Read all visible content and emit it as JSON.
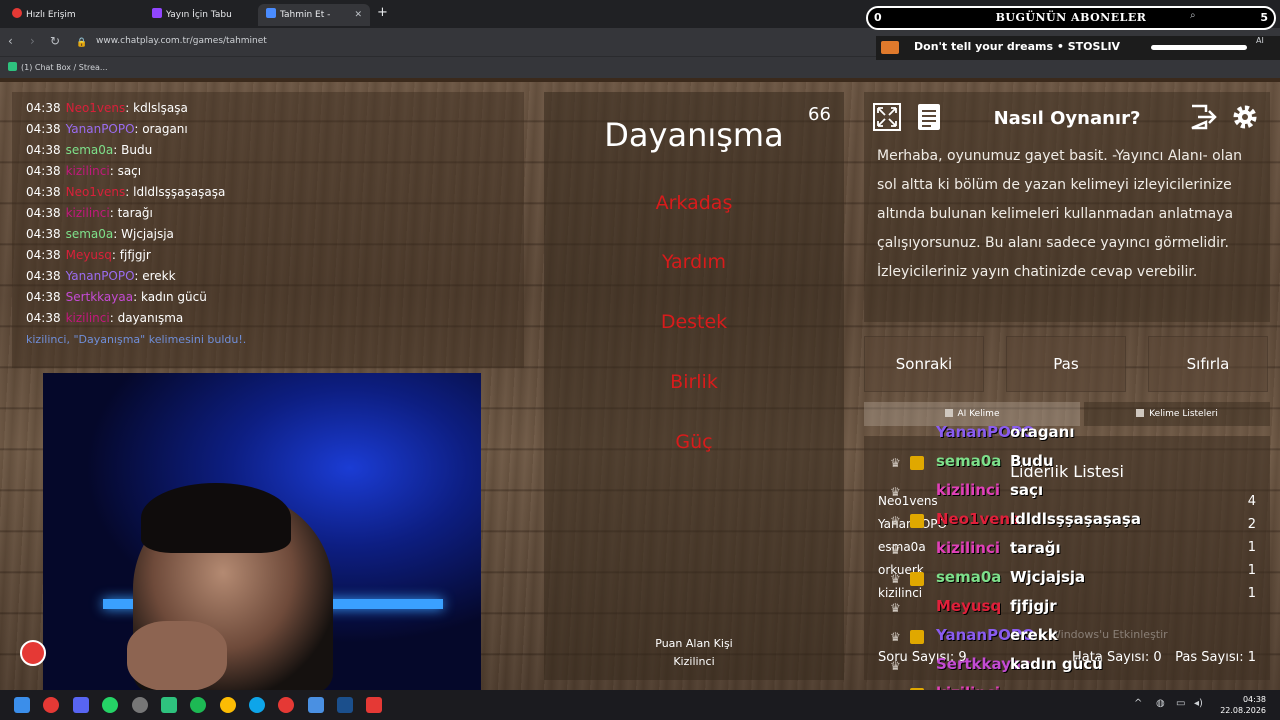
{
  "browser": {
    "tabs": [
      {
        "label": "Hızlı Erişim"
      },
      {
        "label": "Yayın İçin Tabu Oyna"
      },
      {
        "label": "Tahmin Et - ChatPlay"
      }
    ],
    "url": "www.chatplay.com.tr/games/tahminet",
    "bookmark": "(1) Chat Box / Strea..."
  },
  "overlay": {
    "subs_title": "BUGÜNÜN ABONELER",
    "subs_count": "0",
    "subs_count_right": "5",
    "now_playing": "Don't tell your dreams  •  STOSLIV",
    "ai_tag": "AI"
  },
  "chat": {
    "lines": [
      {
        "time": "04:38",
        "user": "Neo1vens",
        "color": "#d8203a",
        "msg": "kdlslşaşa"
      },
      {
        "time": "04:38",
        "user": "YananPOPO",
        "color": "#9a6cf0",
        "msg": "oraganı"
      },
      {
        "time": "04:38",
        "user": "sema0a",
        "color": "#7ee08a",
        "msg": "Budu"
      },
      {
        "time": "04:38",
        "user": "kizilinci",
        "color": "#c2187c",
        "msg": "saçı"
      },
      {
        "time": "04:38",
        "user": "Neo1vens",
        "color": "#d8203a",
        "msg": "ldldlsşşaşaşaşa"
      },
      {
        "time": "04:38",
        "user": "kizilinci",
        "color": "#c2187c",
        "msg": "tarağı"
      },
      {
        "time": "04:38",
        "user": "sema0a",
        "color": "#7ee08a",
        "msg": "Wjcjajsja"
      },
      {
        "time": "04:38",
        "user": "Meyusq",
        "color": "#d8203a",
        "msg": "fjfjgjr"
      },
      {
        "time": "04:38",
        "user": "YananPOPO",
        "color": "#9a6cf0",
        "msg": "erekk"
      },
      {
        "time": "04:38",
        "user": "Sertkkayaa",
        "color": "#c44bd4",
        "msg": "kadın gücü"
      },
      {
        "time": "04:38",
        "user": "kizilinci",
        "color": "#c2187c",
        "msg": "dayanışma"
      }
    ],
    "found": "kizilinci, \"Dayanışma\" kelimesini buldu!."
  },
  "game": {
    "timer": "66",
    "word": "Dayanışma",
    "taboo": [
      "Arkadaş",
      "Yardım",
      "Destek",
      "Birlik",
      "Güç"
    ],
    "scorer_label": "Puan Alan Kişi",
    "scorer_name": "Kizilinci"
  },
  "info": {
    "title": "Nasıl Oynanır?",
    "text": "Merhaba, oyunumuz gayet basit. -Yayıncı Alanı- olan sol altta ki bölüm de yazan kelimeyi izleyicilerinize altında bulunan kelimeleri kullanmadan anlatmaya çalışıyorsunuz. Bu alanı sadece yayıncı görmelidir. İzleyicileriniz yayın chatinizde cevap verebilir."
  },
  "actions": {
    "next": "Sonraki",
    "pass": "Pas",
    "reset": "Sıfırla"
  },
  "lists": {
    "ai_word": "AI Kelime",
    "word_lists": "Kelime Listeleri"
  },
  "leaderboard": {
    "title": "Liderlik Listesi",
    "entries": [
      {
        "name": "Neo1vens",
        "score": "4"
      },
      {
        "name": "YananPOPO",
        "score": "2"
      },
      {
        "name": "esma0a",
        "score": "1"
      },
      {
        "name": "orkuerk",
        "score": "1"
      },
      {
        "name": "kizilinci",
        "score": "1"
      }
    ],
    "question_count": "Soru Sayısı: 9",
    "error_count": "Hata Sayısı: 0",
    "pass_count": "Pas Sayısı: 1"
  },
  "overlay_chat": [
    {
      "user": "YananPOPO",
      "color": "#8a5cf0",
      "msg": "oraganı"
    },
    {
      "user": "sema0a",
      "color": "#7ee08a",
      "msg": "Budu"
    },
    {
      "user": "kizilinci",
      "color": "#e040b8",
      "msg": "saçı"
    },
    {
      "user": "Neo1vens",
      "color": "#e0203a",
      "msg": "ldldlsşşaşaşaşa"
    },
    {
      "user": "kizilinci",
      "color": "#e040b8",
      "msg": "tarağı"
    },
    {
      "user": "sema0a",
      "color": "#7ee08a",
      "msg": "Wjcjajsja"
    },
    {
      "user": "Meyusq",
      "color": "#e0203a",
      "msg": "fjfjgjr"
    },
    {
      "user": "YananPOPO",
      "color": "#8a5cf0",
      "msg": "erekk"
    },
    {
      "user": "Sertkkayaa",
      "color": "#c44bd4",
      "msg": "kadın gücü"
    },
    {
      "user": "kizilinci",
      "color": "#e040b8",
      "msg": ""
    }
  ],
  "watermark": "Windows'u Etkinleştir",
  "taskbar": {
    "time": "04:38",
    "date": "22.08.2026"
  }
}
